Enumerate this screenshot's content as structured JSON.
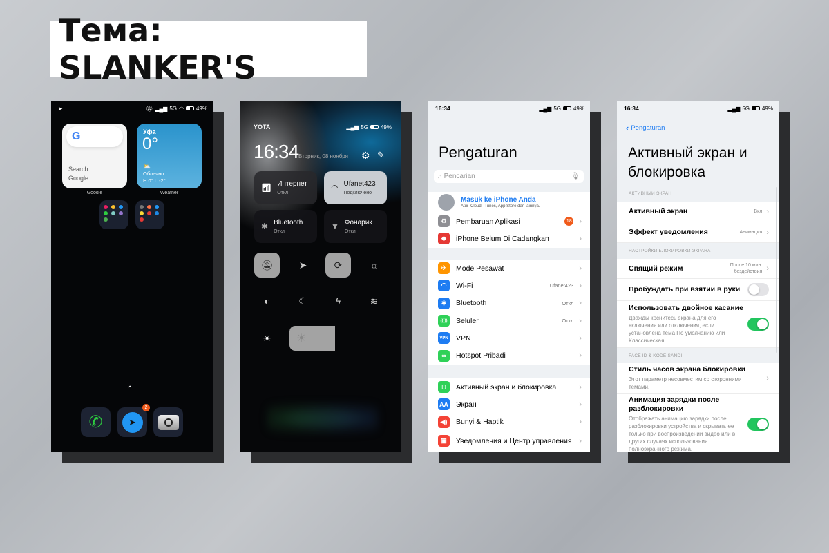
{
  "heading": "Тема: SLANKER'S",
  "status": {
    "network": "5G",
    "battery": "49%",
    "battery_level": 0.49,
    "time": "16:34",
    "carrier": "YOTA"
  },
  "home": {
    "google_widget": {
      "label": "Search Google",
      "caption": "Google"
    },
    "weather_widget": {
      "city": "Уфа",
      "temp": "0°",
      "condition": "Облачно",
      "high": "H:0°",
      "low": "L:-2°",
      "caption": "Weather"
    },
    "dock": [
      {
        "name": "phone"
      },
      {
        "name": "telegram",
        "badge": "2"
      },
      {
        "name": "camera"
      }
    ],
    "colors": {
      "weather": "#3a9fd0",
      "phone": "#2ecc40",
      "telegram": "#2196f3",
      "badge": "#f05a1a"
    }
  },
  "control_center": {
    "date": "Вторник, 08 ноября",
    "tiles": [
      {
        "title": "Интернет",
        "state": "Откл",
        "active": false
      },
      {
        "title": "Ufanet423",
        "state": "Подключено",
        "active": true
      },
      {
        "title": "Bluetooth",
        "state": "Откл",
        "active": false
      },
      {
        "title": "Фонарик",
        "state": "Откл",
        "active": false
      }
    ],
    "toggles": [
      {
        "icon": "mute-bell",
        "active": true
      },
      {
        "icon": "location",
        "active": false
      },
      {
        "icon": "rotation-lock",
        "active": true
      },
      {
        "icon": "sun-moon",
        "active": false
      },
      {
        "icon": "contrast",
        "active": false
      },
      {
        "icon": "moon",
        "active": false
      },
      {
        "icon": "bolt",
        "active": false
      },
      {
        "icon": "layers",
        "active": false
      }
    ],
    "brightness": 0.47
  },
  "settings": {
    "title": "Pengaturan",
    "search_placeholder": "Pencarian",
    "profile": {
      "name": "Masuk ke iPhone Anda",
      "sub": "Atur iCloud, iTunes, App Store dan lainnya."
    },
    "rows": [
      {
        "label": "Pembaruan Aplikasi",
        "badge": "18",
        "color": "#8e8e93"
      },
      {
        "label": "iPhone Belum Di Cadangkan",
        "color": "#e53935"
      },
      {
        "label": "Mode Pesawat",
        "color": "#ff9500"
      },
      {
        "label": "Wi-Fi",
        "value": "Ufanet423",
        "color": "#1e7cf2"
      },
      {
        "label": "Bluetooth",
        "value": "Откл",
        "color": "#1e7cf2"
      },
      {
        "label": "Seluler",
        "value": "Откл",
        "color": "#2fd158"
      },
      {
        "label": "VPN",
        "icon_text": "VPN",
        "color": "#1e7cf2"
      },
      {
        "label": "Hotspot Pribadi",
        "color": "#2fd158"
      },
      {
        "label": "Активный экран и блокировка",
        "color": "#2fd158"
      },
      {
        "label": "Экран",
        "icon_text": "AA",
        "color": "#1e7cf2"
      },
      {
        "label": "Bunyi & Haptik",
        "color": "#f44336"
      },
      {
        "label": "Уведомления и Центр управления",
        "color": "#f44336"
      }
    ]
  },
  "lockscreen": {
    "back": "Pengaturan",
    "title": "Активный экран и блокировка",
    "sections": [
      "АКТИВНЫЙ ЭКРАН",
      "НАСТРОЙКИ БЛОКИРОВКИ ЭКРАНА",
      "FACE ID & KODE SANDI"
    ],
    "rows": [
      {
        "label": "Активный экран",
        "value": "Вкл"
      },
      {
        "label": "Эффект уведомления",
        "value": "Анимация"
      },
      {
        "label": "Спящий режим",
        "value": "После 10 мин. бездействия"
      },
      {
        "label": "Пробуждать при взятии в руки",
        "toggle": false
      },
      {
        "label": "Использовать двойное касание",
        "sub": "Дважды коснитесь экрана для его включения или отключения, если установлена тема По умолчанию или Классическая.",
        "toggle": true
      },
      {
        "label": "Стиль часов экрана блокировки",
        "sub": "Этот параметр несовместим со сторонними темами."
      },
      {
        "label": "Анимация зарядки после разблокировки",
        "sub": "Отображать анимацию зарядки после разблокировки устройства и скрывать ее только при воспроизведении видео или в других случаях использования полноэкранного режима.",
        "toggle": true
      }
    ],
    "toggle_on_color": "#22c55e"
  }
}
